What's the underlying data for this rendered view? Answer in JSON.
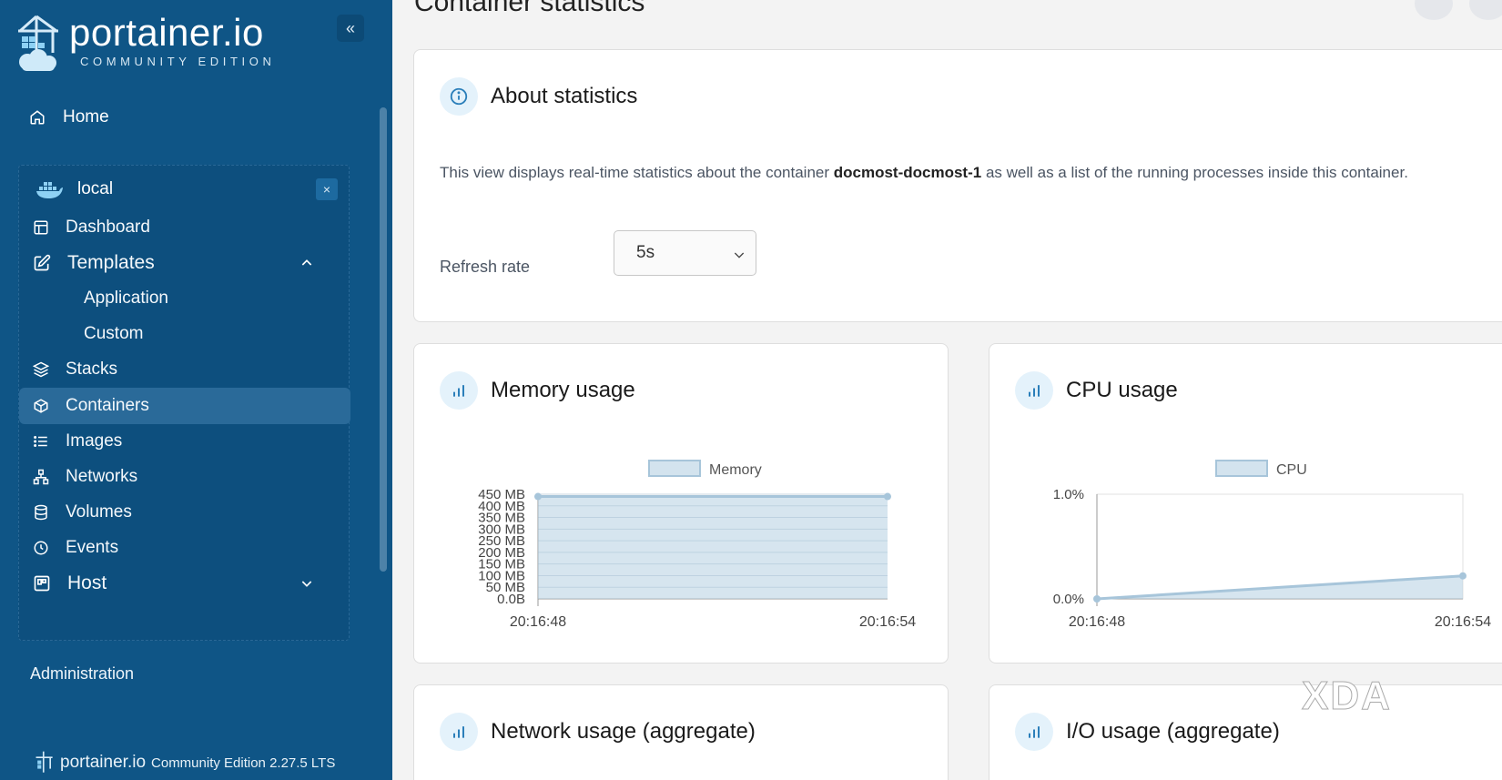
{
  "brand": {
    "name": "portainer.io",
    "edition": "COMMUNITY EDITION",
    "collapse_glyph": "«",
    "footer_name": "portainer.io",
    "footer_edition": "Community Edition 2.27.5 LTS"
  },
  "sidebar": {
    "home": "Home",
    "environment": {
      "name": "local",
      "close_glyph": "×"
    },
    "items": {
      "dashboard": "Dashboard",
      "templates": "Templates",
      "application": "Application",
      "custom": "Custom",
      "stacks": "Stacks",
      "containers": "Containers",
      "images": "Images",
      "networks": "Networks",
      "volumes": "Volumes",
      "events": "Events",
      "host": "Host"
    },
    "active": "containers",
    "administration": "Administration"
  },
  "page": {
    "title": "Container statistics"
  },
  "about": {
    "title": "About statistics",
    "text_before": "This view displays real-time statistics about the container ",
    "container_name": "docmost-docmost-1",
    "text_after": " as well as a list of the running processes inside this container.",
    "refresh_label": "Refresh rate",
    "refresh_value": "5s"
  },
  "cards": {
    "memory": "Memory usage",
    "cpu": "CPU usage",
    "network": "Network usage (aggregate)",
    "io": "I/O usage (aggregate)"
  },
  "watermark": "XDA",
  "colors": {
    "sidebar": "#0f5586",
    "accent": "#2a6a99",
    "chart_fill": "#d3e3ee",
    "chart_line": "#a7c5da"
  },
  "chart_data": [
    {
      "type": "area",
      "title": "Memory usage",
      "series": [
        {
          "name": "Memory",
          "values": [
            440,
            440
          ]
        }
      ],
      "x": [
        "20:16:48",
        "20:16:54"
      ],
      "y_ticks": [
        "450 MB",
        "400 MB",
        "350 MB",
        "300 MB",
        "250 MB",
        "200 MB",
        "150 MB",
        "100 MB",
        "50 MB",
        "0.0B"
      ],
      "y_tick_values": [
        450,
        400,
        350,
        300,
        250,
        200,
        150,
        100,
        50,
        0
      ],
      "ylim": [
        0,
        450
      ],
      "unit": "MB",
      "grid": true,
      "legend": "top"
    },
    {
      "type": "area",
      "title": "CPU usage",
      "series": [
        {
          "name": "CPU",
          "values": [
            0.0,
            0.22
          ]
        }
      ],
      "x": [
        "20:16:48",
        "20:16:54"
      ],
      "y_ticks": [
        "1.0%",
        "0.0%"
      ],
      "y_tick_values": [
        1.0,
        0.0
      ],
      "ylim": [
        0,
        1.0
      ],
      "unit": "%",
      "grid": false,
      "legend": "top"
    }
  ]
}
